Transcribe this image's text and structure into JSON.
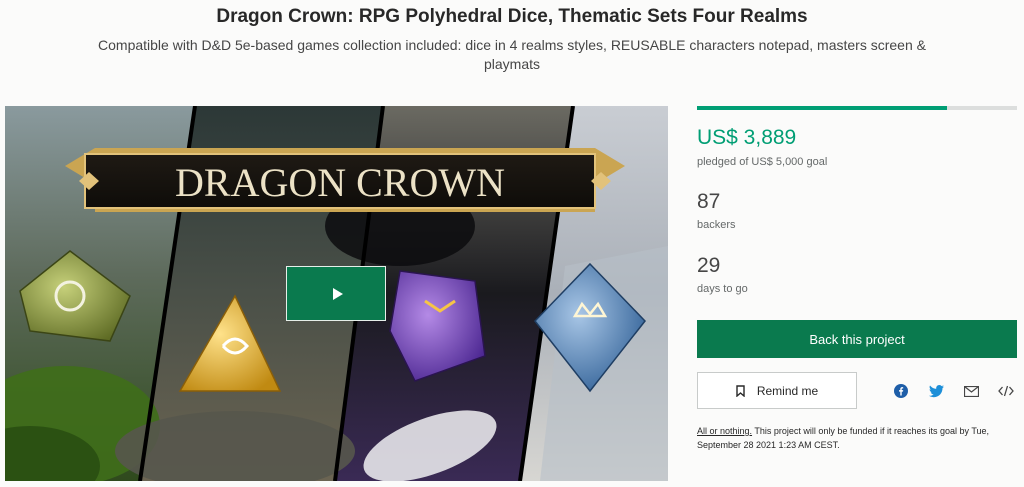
{
  "header": {
    "title": "Dragon Crown: RPG Polyhedral Dice, Thematic Sets Four Realms",
    "subtitle": "Compatible with D&D 5e-based games collection included: dice in 4 realms styles, REUSABLE characters notepad, masters screen & playmats"
  },
  "video": {
    "banner_text": "DRAGON CROWN",
    "play_icon": "play-icon"
  },
  "stats": {
    "progress_fraction": 0.78,
    "pledged": "US$ 3,889",
    "pledged_label": "pledged of US$ 5,000 goal",
    "backers": "87",
    "backers_label": "backers",
    "days": "29",
    "days_label": "days to go"
  },
  "actions": {
    "back_label": "Back this project",
    "remind_label": "Remind me",
    "remind_icon": "bookmark-icon",
    "share_icons": [
      "facebook-icon",
      "twitter-icon",
      "email-icon",
      "embed-icon"
    ]
  },
  "notice": {
    "link": "All or nothing.",
    "text": " This project will only be funded if it reaches its goal by Tue, September 28 2021 1:23 AM CEST."
  },
  "colors": {
    "accent": "#009e74",
    "button": "#0a7a4e"
  }
}
